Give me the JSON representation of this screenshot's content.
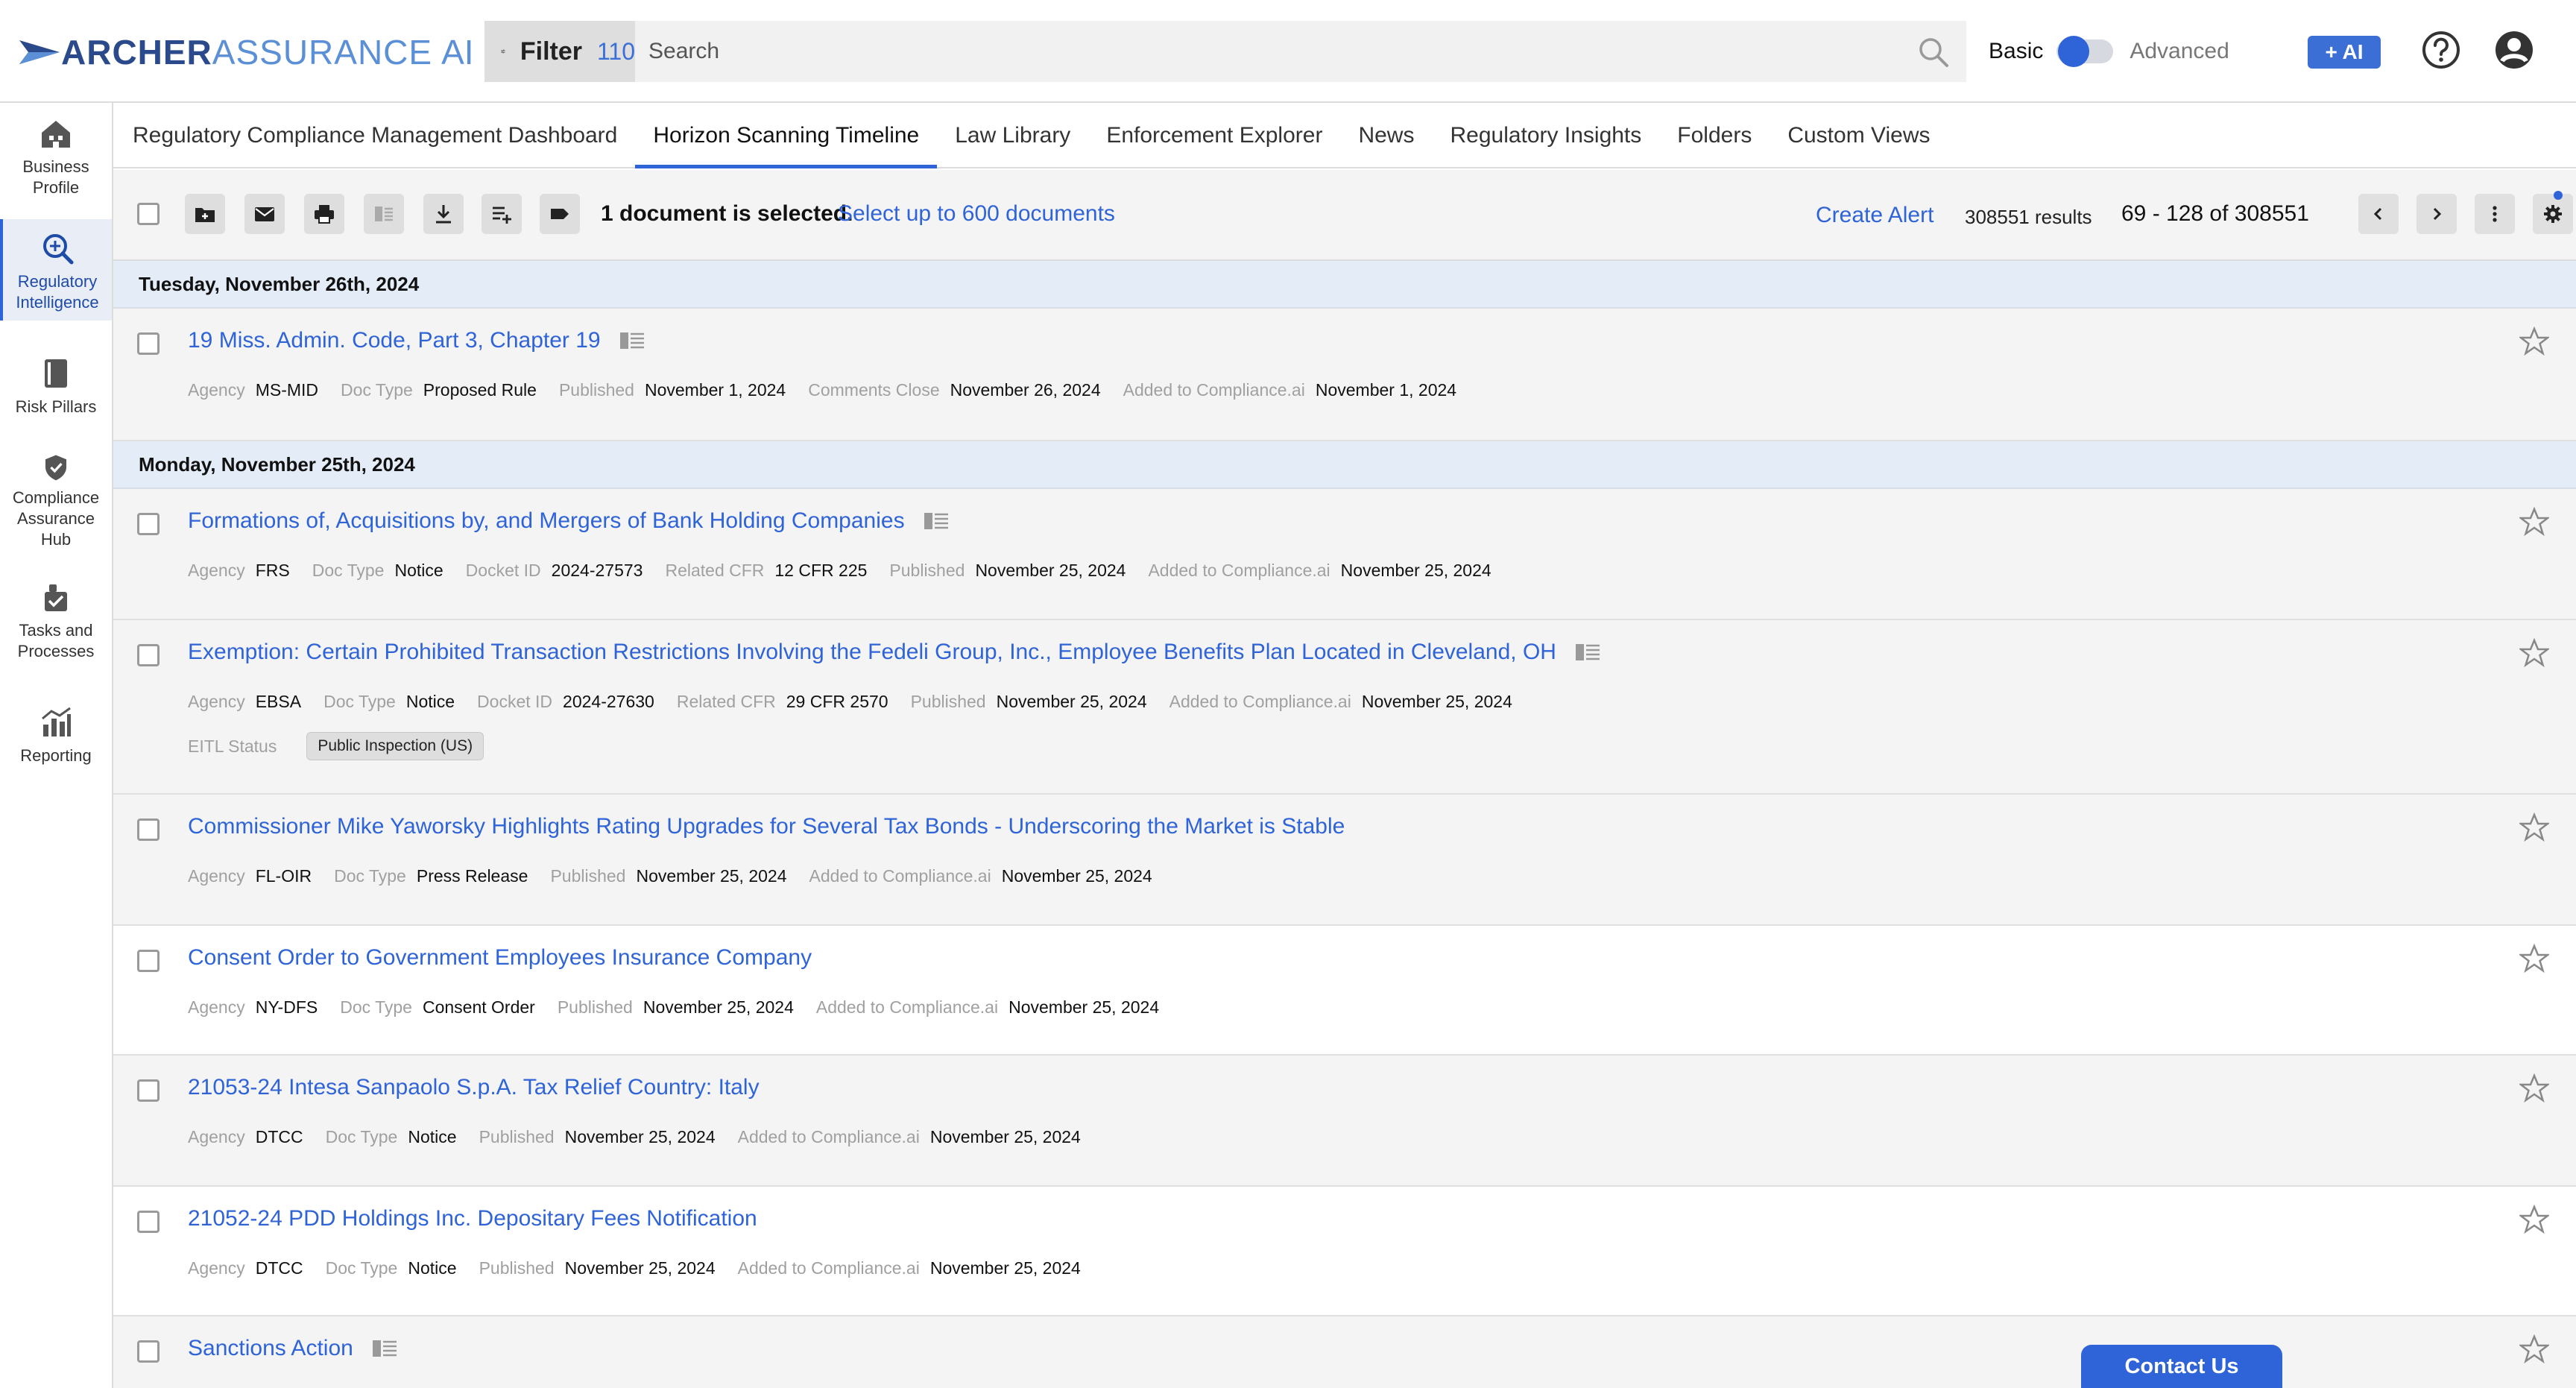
{
  "app": {
    "logo_word1": "ARCHER",
    "logo_word2": "ASSURANCE",
    "logo_word3": "AI"
  },
  "header": {
    "filter_label": "Filter",
    "filter_count": "110",
    "search_placeholder": "Search",
    "mode_basic": "Basic",
    "mode_advanced": "Advanced",
    "mode_selected": "Basic",
    "ai_label": "+ AI",
    "icons": {
      "filter": "sliders-icon",
      "search": "search-icon",
      "help": "help-circle-icon",
      "account": "account-circle-icon"
    }
  },
  "sidenav": {
    "items": [
      {
        "label": "Business\nProfile",
        "icon": "building-icon",
        "active": false
      },
      {
        "label": "Regulatory\nIntelligence",
        "icon": "magnifier-plus-icon",
        "active": true
      },
      {
        "label": "Risk Pillars",
        "icon": "book-icon",
        "active": false
      },
      {
        "label": "Compliance\nAssurance\nHub",
        "icon": "shield-check-icon",
        "active": false
      },
      {
        "label": "Tasks and\nProcesses",
        "icon": "tasks-icon",
        "active": false
      },
      {
        "label": "Reporting",
        "icon": "chart-icon",
        "active": false
      }
    ]
  },
  "tabs": [
    {
      "label": "Regulatory Compliance Management Dashboard",
      "active": false
    },
    {
      "label": "Horizon Scanning Timeline",
      "active": true
    },
    {
      "label": "Law Library",
      "active": false
    },
    {
      "label": "Enforcement Explorer",
      "active": false
    },
    {
      "label": "News",
      "active": false
    },
    {
      "label": "Regulatory Insights",
      "active": false
    },
    {
      "label": "Folders",
      "active": false
    },
    {
      "label": "Custom Views",
      "active": false
    }
  ],
  "toolbar": {
    "selection_text": "1 document is selected.",
    "selection_link": "Select up to 600 documents",
    "create_alert": "Create Alert",
    "results": "308551 results",
    "page_range": "69 - 128 of 308551",
    "actions": [
      "add-to-folder-icon",
      "email-icon",
      "print-icon",
      "compare-icon",
      "download-icon",
      "add-to-list-icon",
      "label-icon"
    ]
  },
  "groups": [
    {
      "date": "Tuesday, November 26th, 2024",
      "docs": [
        {
          "title": "19 Miss. Admin. Code, Part 3, Chapter 19",
          "has_doc_icon": true,
          "meta": [
            [
              "Agency",
              "MS-MID"
            ],
            [
              "Doc Type",
              "Proposed Rule"
            ],
            [
              "Published",
              "November 1, 2024"
            ],
            [
              "Comments Close",
              "November 26, 2024"
            ],
            [
              "Added to Compliance.ai",
              "November 1, 2024"
            ]
          ]
        }
      ]
    },
    {
      "date": "Monday, November 25th, 2024",
      "docs": [
        {
          "title": "Formations of, Acquisitions by, and Mergers of Bank Holding Companies",
          "has_doc_icon": true,
          "meta": [
            [
              "Agency",
              "FRS"
            ],
            [
              "Doc Type",
              "Notice"
            ],
            [
              "Docket ID",
              "2024-27573"
            ],
            [
              "Related CFR",
              "12 CFR 225"
            ],
            [
              "Published",
              "November 25, 2024"
            ],
            [
              "Added to Compliance.ai",
              "November 25, 2024"
            ]
          ]
        },
        {
          "title": "Exemption: Certain Prohibited Transaction Restrictions Involving the Fedeli Group, Inc., Employee Benefits Plan Located in Cleveland, OH",
          "has_doc_icon": true,
          "meta": [
            [
              "Agency",
              "EBSA"
            ],
            [
              "Doc Type",
              "Notice"
            ],
            [
              "Docket ID",
              "2024-27630"
            ],
            [
              "Related CFR",
              "29 CFR 2570"
            ],
            [
              "Published",
              "November 25, 2024"
            ],
            [
              "Added to Compliance.ai",
              "November 25, 2024"
            ]
          ],
          "status_label": "EITL Status",
          "status_value": "Public Inspection (US)"
        },
        {
          "title": "Commissioner Mike Yaworsky Highlights Rating Upgrades for Several Tax Bonds - Underscoring the Market is Stable",
          "has_doc_icon": false,
          "meta": [
            [
              "Agency",
              "FL-OIR"
            ],
            [
              "Doc Type",
              "Press Release"
            ],
            [
              "Published",
              "November 25, 2024"
            ],
            [
              "Added to Compliance.ai",
              "November 25, 2024"
            ]
          ]
        },
        {
          "title": "Consent Order to Government Employees Insurance Company",
          "has_doc_icon": false,
          "meta": [
            [
              "Agency",
              "NY-DFS"
            ],
            [
              "Doc Type",
              "Consent Order"
            ],
            [
              "Published",
              "November 25, 2024"
            ],
            [
              "Added to Compliance.ai",
              "November 25, 2024"
            ]
          ]
        },
        {
          "title": "21053-24 Intesa Sanpaolo S.p.A. Tax Relief Country: Italy",
          "has_doc_icon": false,
          "meta": [
            [
              "Agency",
              "DTCC"
            ],
            [
              "Doc Type",
              "Notice"
            ],
            [
              "Published",
              "November 25, 2024"
            ],
            [
              "Added to Compliance.ai",
              "November 25, 2024"
            ]
          ]
        },
        {
          "title": "21052-24 PDD Holdings Inc. Depositary Fees Notification",
          "has_doc_icon": false,
          "meta": [
            [
              "Agency",
              "DTCC"
            ],
            [
              "Doc Type",
              "Notice"
            ],
            [
              "Published",
              "November 25, 2024"
            ],
            [
              "Added to Compliance.ai",
              "November 25, 2024"
            ]
          ]
        },
        {
          "title": "Sanctions Action",
          "has_doc_icon": true,
          "meta": []
        }
      ]
    }
  ],
  "contact_us": "Contact Us",
  "colors": {
    "accent": "#2f63d8",
    "brand_dark": "#2b4a8b",
    "brand_light": "#5b8fd6",
    "date_header_bg": "#e4ecf7"
  }
}
